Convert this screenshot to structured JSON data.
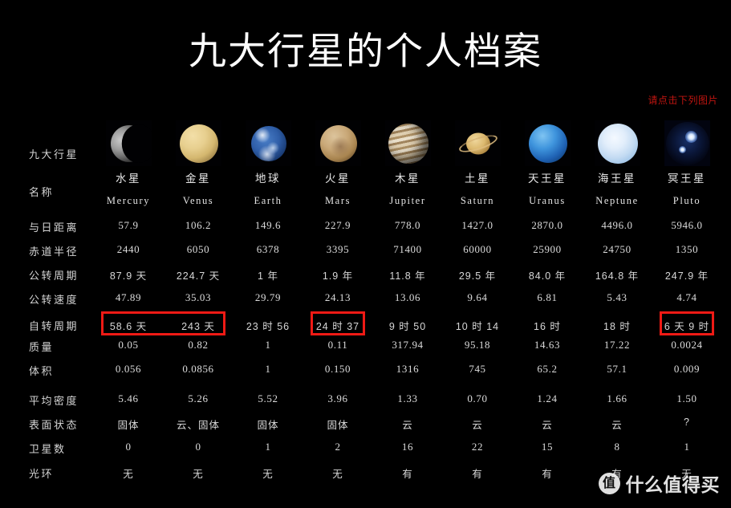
{
  "page": {
    "title": "九大行星的个人档案",
    "hint": "请点击下列图片",
    "background_color": "#000000",
    "text_color": "#d8d8d8",
    "hint_color": "#c01510",
    "highlight_color": "#ef1a15"
  },
  "watermark": {
    "logo_glyph": "值",
    "text": "什么值得买"
  },
  "table": {
    "row_labels": [
      "九大行星",
      "名称",
      "与日距离",
      "赤道半径",
      "公转周期",
      "公转速度",
      "自转周期",
      "质量",
      "体积",
      "平均密度",
      "表面状态",
      "卫星数",
      "光环"
    ],
    "planets": [
      {
        "icon": "mercury-planet-icon",
        "name_cn": "水星",
        "name_en": "Mercury"
      },
      {
        "icon": "venus-planet-icon",
        "name_cn": "金星",
        "name_en": "Venus"
      },
      {
        "icon": "earth-planet-icon",
        "name_cn": "地球",
        "name_en": "Earth"
      },
      {
        "icon": "mars-planet-icon",
        "name_cn": "火星",
        "name_en": "Mars"
      },
      {
        "icon": "jupiter-planet-icon",
        "name_cn": "木星",
        "name_en": "Jupiter"
      },
      {
        "icon": "saturn-planet-icon",
        "name_cn": "土星",
        "name_en": "Saturn"
      },
      {
        "icon": "uranus-planet-icon",
        "name_cn": "天王星",
        "name_en": "Uranus"
      },
      {
        "icon": "neptune-planet-icon",
        "name_cn": "海王星",
        "name_en": "Neptune"
      },
      {
        "icon": "pluto-planet-icon",
        "name_cn": "冥王星",
        "name_en": "Pluto"
      }
    ],
    "rows": {
      "distance": [
        "57.9",
        "106.2",
        "149.6",
        "227.9",
        "778.0",
        "1427.0",
        "2870.0",
        "4496.0",
        "5946.0"
      ],
      "radius": [
        "2440",
        "6050",
        "6378",
        "3395",
        "71400",
        "60000",
        "25900",
        "24750",
        "1350"
      ],
      "orbital_period": [
        "87.9 天",
        "224.7 天",
        "1 年",
        "1.9 年",
        "11.8 年",
        "29.5 年",
        "84.0 年",
        "164.8 年",
        "247.9 年"
      ],
      "orbital_speed": [
        "47.89",
        "35.03",
        "29.79",
        "24.13",
        "13.06",
        "9.64",
        "6.81",
        "5.43",
        "4.74"
      ],
      "rotation": [
        "58.6 天",
        "243 天",
        "23 时 56",
        "24 时 37",
        "9 时 50",
        "10 时 14",
        "16 时",
        "18 时",
        "6 天 9 时"
      ],
      "mass": [
        "0.05",
        "0.82",
        "1",
        "0.11",
        "317.94",
        "95.18",
        "14.63",
        "17.22",
        "0.0024"
      ],
      "volume": [
        "0.056",
        "0.0856",
        "1",
        "0.150",
        "1316",
        "745",
        "65.2",
        "57.1",
        "0.009"
      ],
      "density": [
        "5.46",
        "5.26",
        "5.52",
        "3.96",
        "1.33",
        "0.70",
        "1.24",
        "1.66",
        "1.50"
      ],
      "surface": [
        "固体",
        "云、固体",
        "固体",
        "固体",
        "云",
        "云",
        "云",
        "云",
        "?"
      ],
      "satellites": [
        "0",
        "0",
        "1",
        "2",
        "16",
        "22",
        "15",
        "8",
        "1"
      ],
      "rings": [
        "无",
        "无",
        "无",
        "无",
        "有",
        "有",
        "有",
        "有",
        "无"
      ]
    },
    "highlights": [
      {
        "row": "rotation",
        "columns": [
          0,
          1
        ],
        "label": "rotation-highlight-mercury-venus"
      },
      {
        "row": "rotation",
        "columns": [
          3
        ],
        "label": "rotation-highlight-mars"
      },
      {
        "row": "rotation",
        "columns": [
          8
        ],
        "label": "rotation-highlight-pluto"
      }
    ]
  }
}
